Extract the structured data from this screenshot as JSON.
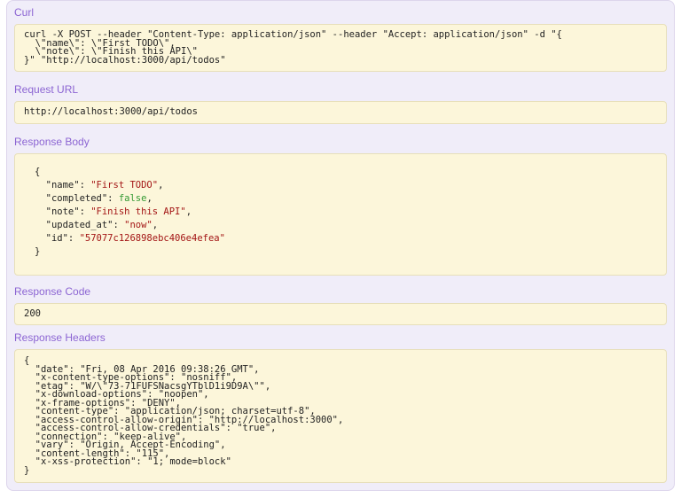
{
  "colors": {
    "page_bg": "#ffffff",
    "panel_bg": "#f0edf9",
    "panel_border": "#ddd5ec",
    "code_block_bg": "#fcf6da",
    "code_block_border": "#e7dfba",
    "section_heading": "#8c65d3",
    "code_text": "#222222",
    "json_string": "#a31515",
    "json_literal": "#339933"
  },
  "sections": {
    "curl": {
      "title": "Curl",
      "lines": [
        "curl -X POST --header \"Content-Type: application/json\" --header \"Accept: application/json\" -d \"{",
        "  \\\"name\\\": \\\"First TODO\\\",",
        "  \\\"note\\\": \\\"Finish this API\\\"",
        "}\" \"http://localhost:3000/api/todos\""
      ]
    },
    "request_url": {
      "title": "Request URL",
      "value": "http://localhost:3000/api/todos"
    },
    "response_body": {
      "title": "Response Body",
      "token_lines": [
        [
          {
            "t": "{"
          }
        ],
        [
          {
            "t": "  \"name\": "
          },
          {
            "t": "\"First TODO\"",
            "c": "string"
          },
          {
            "t": ","
          }
        ],
        [
          {
            "t": "  \"completed\": "
          },
          {
            "t": "false",
            "c": "literal"
          },
          {
            "t": ","
          }
        ],
        [
          {
            "t": "  \"note\": "
          },
          {
            "t": "\"Finish this API\"",
            "c": "string"
          },
          {
            "t": ","
          }
        ],
        [
          {
            "t": "  \"updated_at\": "
          },
          {
            "t": "\"now\"",
            "c": "string"
          },
          {
            "t": ","
          }
        ],
        [
          {
            "t": "  \"id\": "
          },
          {
            "t": "\"57077c126898ebc406e4efea\"",
            "c": "string"
          }
        ],
        [
          {
            "t": "}"
          }
        ]
      ]
    },
    "response_code": {
      "title": "Response Code",
      "value": "200"
    },
    "response_headers": {
      "title": "Response Headers",
      "lines": [
        "{",
        "  \"date\": \"Fri, 08 Apr 2016 09:38:26 GMT\",",
        "  \"x-content-type-options\": \"nosniff\",",
        "  \"etag\": \"W/\\\"73-71FUFSNacsgYTblD1i9D9A\\\"\",",
        "  \"x-download-options\": \"noopen\",",
        "  \"x-frame-options\": \"DENY\",",
        "  \"content-type\": \"application/json; charset=utf-8\",",
        "  \"access-control-allow-origin\": \"http://localhost:3000\",",
        "  \"access-control-allow-credentials\": \"true\",",
        "  \"connection\": \"keep-alive\",",
        "  \"vary\": \"Origin, Accept-Encoding\",",
        "  \"content-length\": \"115\",",
        "  \"x-xss-protection\": \"1; mode=block\"",
        "}"
      ]
    }
  }
}
